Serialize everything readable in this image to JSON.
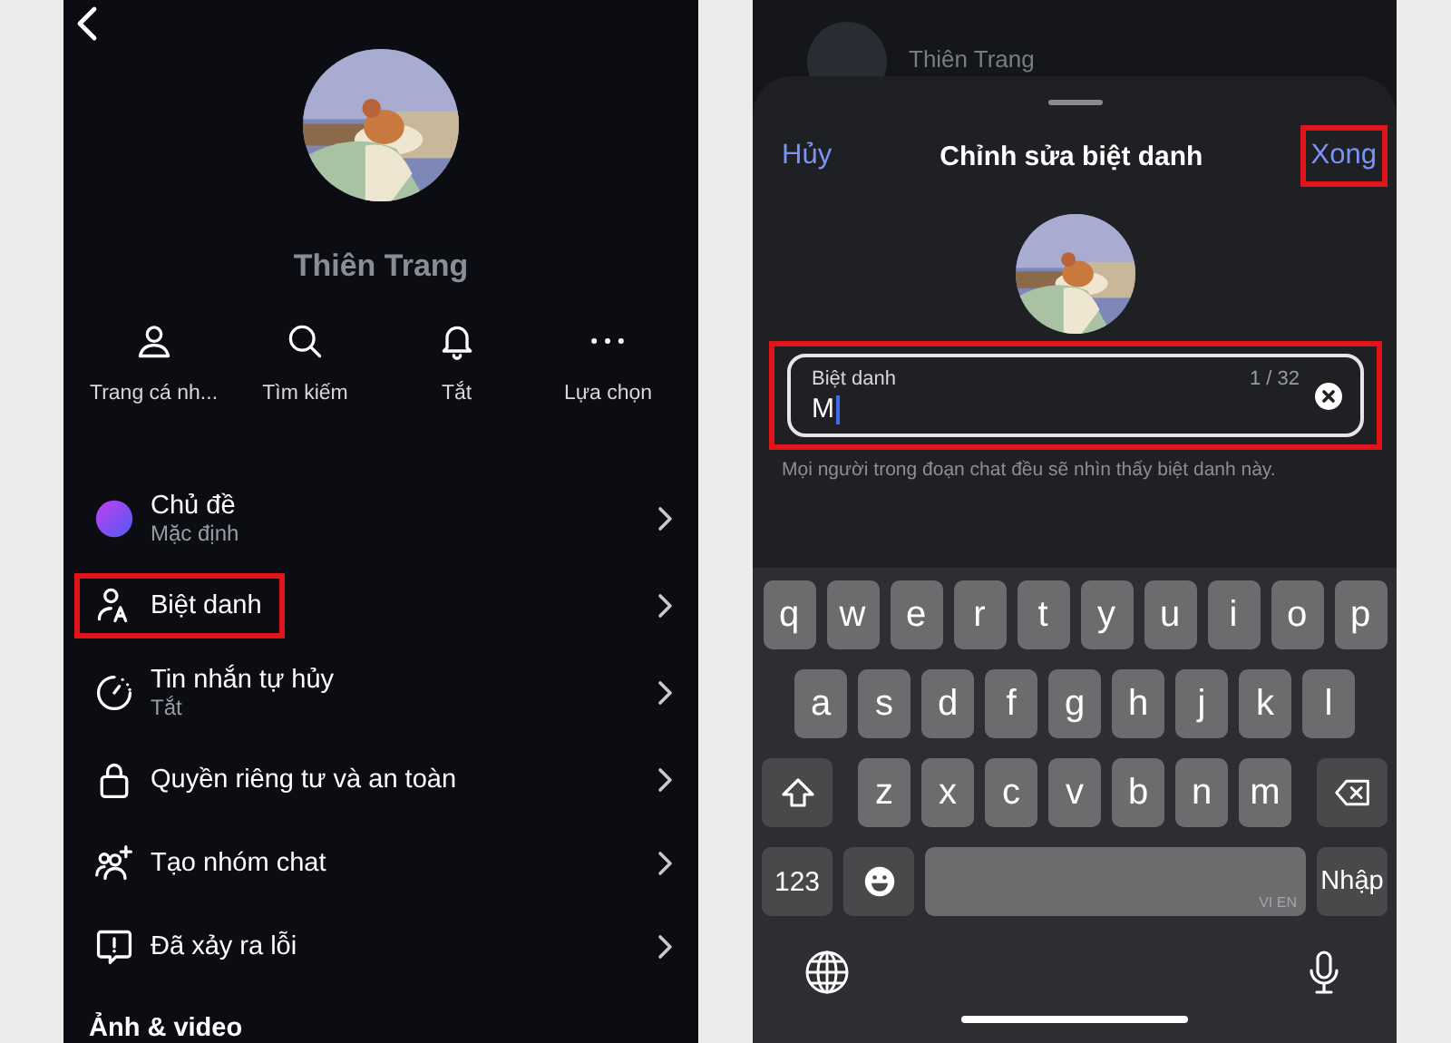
{
  "left_screen": {
    "name": "Thiên Trang",
    "actions": [
      {
        "label": "Trang cá nh..."
      },
      {
        "label": "Tìm kiếm"
      },
      {
        "label": "Tắt"
      },
      {
        "label": "Lựa chọn"
      }
    ],
    "menu": [
      {
        "title": "Chủ đề",
        "subtitle": "Mặc định",
        "highlighted": false
      },
      {
        "title": "Biệt danh",
        "highlighted": true
      },
      {
        "title": "Tin nhắn tự hủy",
        "subtitle": "Tắt",
        "highlighted": false
      },
      {
        "title": "Quyền riêng tư và an toàn",
        "highlighted": false
      },
      {
        "title": "Tạo nhóm chat",
        "highlighted": false
      },
      {
        "title": "Đã xảy ra lỗi",
        "highlighted": false
      }
    ],
    "section_heading": "Ảnh & video"
  },
  "right_screen": {
    "background_name": "Thiên Trang",
    "sheet": {
      "cancel": "Hủy",
      "title": "Chỉnh sửa biệt danh",
      "done": {
        "label": "Xong",
        "highlighted": true
      },
      "field": {
        "label": "Biệt danh",
        "value": "M",
        "counter": "1 / 32",
        "highlighted": true
      },
      "hint": "Mọi người trong đoạn chat đều sẽ nhìn thấy biệt danh này."
    },
    "keyboard": {
      "rows": [
        [
          "q",
          "w",
          "e",
          "r",
          "t",
          "y",
          "u",
          "i",
          "o",
          "p"
        ],
        [
          "a",
          "s",
          "d",
          "f",
          "g",
          "h",
          "j",
          "k",
          "l"
        ],
        [
          "z",
          "x",
          "c",
          "v",
          "b",
          "n",
          "m"
        ]
      ],
      "numbers_key": "123",
      "space_hint": "VI EN",
      "return_key": "Nhập"
    }
  }
}
